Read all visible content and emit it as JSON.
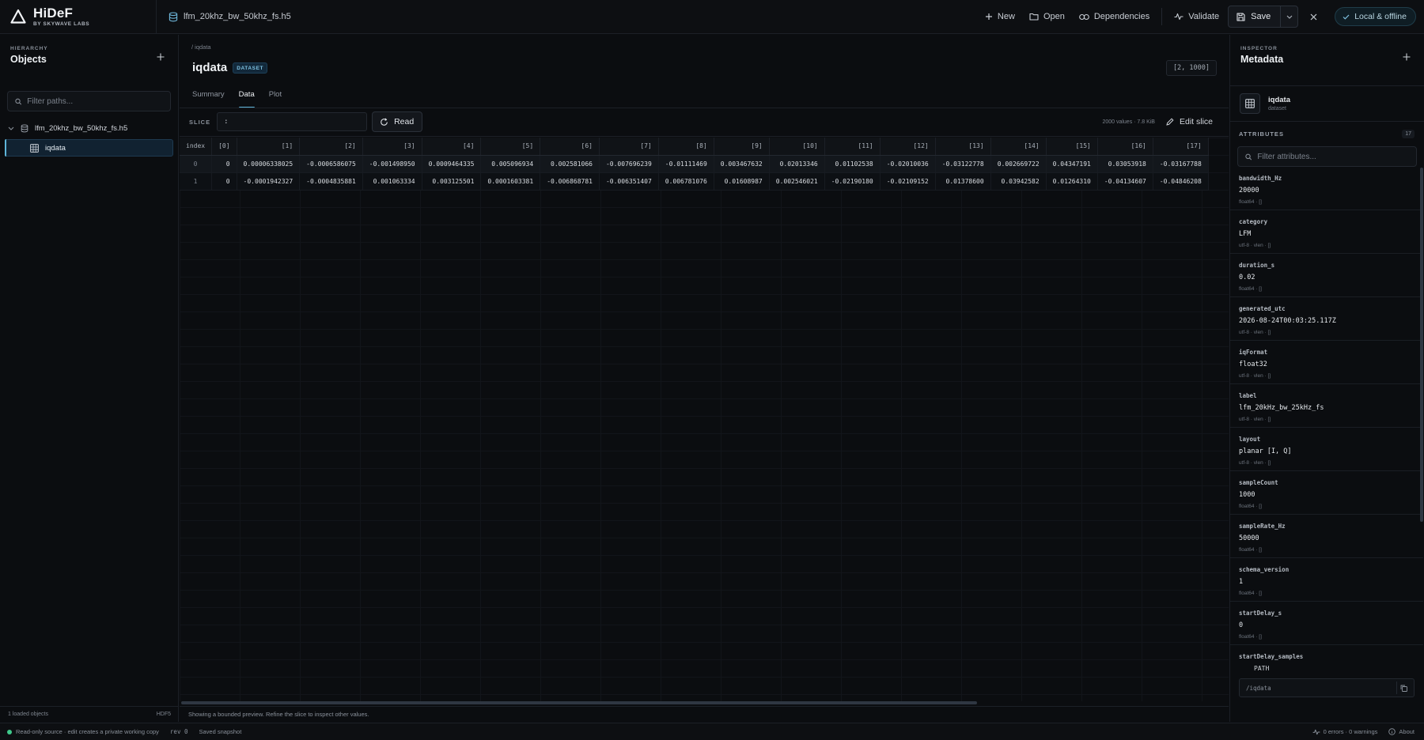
{
  "app": {
    "name": "HiDeF",
    "subtitle": "BY SKYWAVE LABS"
  },
  "file": {
    "name": "lfm_20khz_bw_50khz_fs.h5"
  },
  "toolbar": {
    "new_label": "New",
    "open_label": "Open",
    "dependencies_label": "Dependencies",
    "validate_label": "Validate",
    "save_label": "Save",
    "mode_label": "Local & offline"
  },
  "hierarchy": {
    "eyebrow": "HIERARCHY",
    "title": "Objects",
    "filter_placeholder": "Filter paths...",
    "root_label": "lfm_20khz_bw_50khz_fs.h5",
    "child_label": "iqdata",
    "footer_count": "1 loaded objects",
    "footer_format": "HDF5"
  },
  "dataset": {
    "breadcrumb": "/  iqdata",
    "name": "iqdata",
    "badge": "DATASET",
    "shape": "[2, 1000]",
    "tabs": [
      "Summary",
      "Data",
      "Plot"
    ],
    "active_tab": "Data",
    "slice_label": "SLICE",
    "slice_value": ":",
    "read_label": "Read",
    "meta": "2000 values · 7.8 KiB",
    "edit_slice_label": "Edit slice",
    "footer_note": "Showing a bounded preview. Refine the slice to inspect other values."
  },
  "table": {
    "columns": [
      "index",
      "[0]",
      "[1]",
      "[2]",
      "[3]",
      "[4]",
      "[5]",
      "[6]",
      "[7]",
      "[8]",
      "[9]",
      "[10]",
      "[11]",
      "[12]",
      "[13]",
      "[14]",
      "[15]",
      "[16]",
      "[17]"
    ],
    "rows": [
      [
        "0",
        "0",
        "0.00006338025",
        "-0.0006586075",
        "-0.001498950",
        "0.0009464335",
        "0.005096934",
        "0.002581066",
        "-0.007696239",
        "-0.01111469",
        "0.003467632",
        "0.02013346",
        "0.01102538",
        "-0.02010036",
        "-0.03122778",
        "0.002669722",
        "0.04347191",
        "0.03053918",
        "-0.03167788"
      ],
      [
        "1",
        "0",
        "-0.0001942327",
        "-0.0004835881",
        "0.001063334",
        "0.003125501",
        "0.0001603381",
        "-0.006868781",
        "-0.006351407",
        "0.006781076",
        "0.01608987",
        "0.002546021",
        "-0.02190180",
        "-0.02109152",
        "0.01378600",
        "0.03942582",
        "0.01264310",
        "-0.04134607",
        "-0.04846208"
      ]
    ]
  },
  "inspector": {
    "eyebrow": "INSPECTOR",
    "title": "Metadata",
    "object_name": "iqdata",
    "object_kind": "dataset",
    "attributes_label": "ATTRIBUTES",
    "attributes_count": "17",
    "filter_placeholder": "Filter attributes...",
    "attributes": [
      {
        "key": "bandwidth_Hz",
        "value": "20000",
        "type": "float64 · []"
      },
      {
        "key": "category",
        "value": "LFM",
        "type": "utf-8 · vlen · []"
      },
      {
        "key": "duration_s",
        "value": "0.02",
        "type": "float64 · []"
      },
      {
        "key": "generated_utc",
        "value": "2026-08-24T00:03:25.117Z",
        "type": "utf-8 · vlen · []"
      },
      {
        "key": "iqFormat",
        "value": "float32",
        "type": "utf-8 · vlen · []"
      },
      {
        "key": "label",
        "value": "lfm_20kHz_bw_25kHz_fs",
        "type": "utf-8 · vlen · []"
      },
      {
        "key": "layout",
        "value": "planar [I, Q]",
        "type": "utf-8 · vlen · []"
      },
      {
        "key": "sampleCount",
        "value": "1000",
        "type": "float64 · []"
      },
      {
        "key": "sampleRate_Hz",
        "value": "50000",
        "type": "float64 · []"
      },
      {
        "key": "schema_version",
        "value": "1",
        "type": "float64 · []"
      },
      {
        "key": "startDelay_s",
        "value": "0",
        "type": "float64 · []"
      },
      {
        "key": "startDelay_samples",
        "value": "0",
        "type": "float64 · []"
      }
    ],
    "path_label": "PATH",
    "path_value": "/iqdata"
  },
  "status": {
    "source_note": "Read-only source · edit creates a private working copy",
    "rev": "rev  0",
    "snapshot": "Saved snapshot",
    "diagnostics": "0 errors · 0 warnings",
    "about_label": "About"
  },
  "colors": {
    "accent": "#5fb5d9",
    "ok": "#3fc98b",
    "bg": "#0b0d10"
  }
}
